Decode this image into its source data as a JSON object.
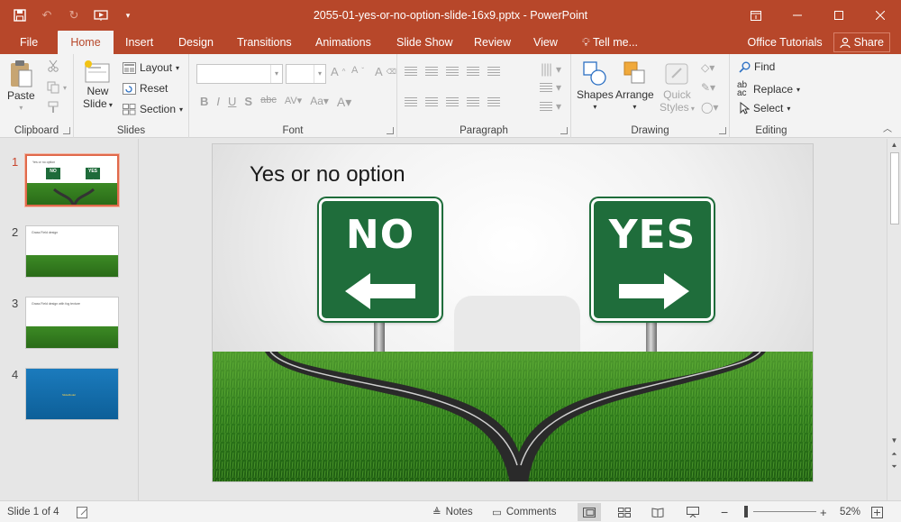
{
  "app": {
    "title": "2055-01-yes-or-no-option-slide-16x9.pptx - PowerPoint",
    "accent": "#b7472a"
  },
  "quick_access": [
    {
      "icon": "save-icon"
    },
    {
      "icon": "undo-icon"
    },
    {
      "icon": "redo-icon"
    },
    {
      "icon": "present-from-start-icon"
    },
    {
      "icon": "customize-qat-icon"
    }
  ],
  "window_controls": [
    "ribbon-display-options-icon",
    "minimize-icon",
    "maximize-icon",
    "close-icon"
  ],
  "tabs": {
    "file": "File",
    "home": "Home",
    "insert": "Insert",
    "design": "Design",
    "transitions": "Transitions",
    "animations": "Animations",
    "slideshow": "Slide Show",
    "review": "Review",
    "view": "View",
    "tell": "Tell me...",
    "office_tutorials": "Office Tutorials",
    "share": "Share",
    "active": "Home"
  },
  "ribbon": {
    "clipboard": {
      "label": "Clipboard",
      "paste": "Paste"
    },
    "slides": {
      "label": "Slides",
      "new_slide_1": "New",
      "new_slide_2": "Slide",
      "layout": "Layout",
      "reset": "Reset",
      "section": "Section"
    },
    "font": {
      "label": "Font"
    },
    "paragraph": {
      "label": "Paragraph"
    },
    "drawing": {
      "label": "Drawing",
      "shapes": "Shapes",
      "arrange": "Arrange",
      "quick_styles_1": "Quick",
      "quick_styles_2": "Styles"
    },
    "editing": {
      "label": "Editing",
      "find": "Find",
      "replace": "Replace",
      "select": "Select"
    }
  },
  "thumbnails": [
    {
      "number": "1",
      "title": "Yes or no option",
      "selected": true,
      "kind": "signs",
      "no": "NO",
      "yes": "YES"
    },
    {
      "number": "2",
      "title": "Grass Field design",
      "selected": false,
      "kind": "grass"
    },
    {
      "number": "3",
      "title": "Grass Field design with fog texture",
      "selected": false,
      "kind": "grass"
    },
    {
      "number": "4",
      "title": "SlideModel",
      "selected": false,
      "kind": "blue"
    }
  ],
  "slide": {
    "title": "Yes or no option",
    "sign_left": "NO",
    "sign_right": "YES",
    "sign_color": "#1f6d3b"
  },
  "status": {
    "slide_counter": "Slide 1 of 4",
    "notes": "Notes",
    "comments": "Comments",
    "zoom": "52%"
  }
}
